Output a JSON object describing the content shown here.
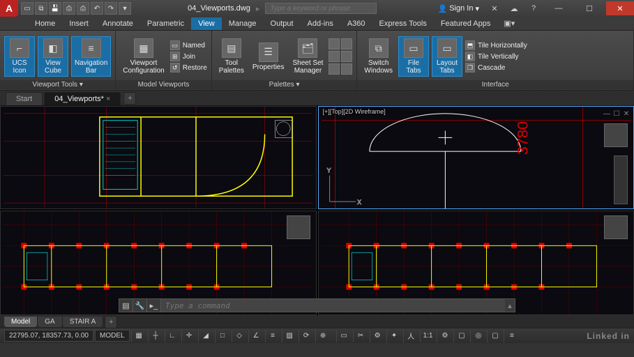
{
  "title": {
    "doc": "04_Viewports.dwg",
    "search_placeholder": "Type a keyword or phrase",
    "signin": "Sign In"
  },
  "tabs": [
    "Home",
    "Insert",
    "Annotate",
    "Parametric",
    "View",
    "Manage",
    "Output",
    "Add-ins",
    "A360",
    "Express Tools",
    "Featured Apps"
  ],
  "tabs_active": 4,
  "ribbon": {
    "viewport_tools": {
      "title": "Viewport Tools ▾",
      "ucs": "UCS\nIcon",
      "view": "View\nCube",
      "nav": "Navigation\nBar"
    },
    "model_viewports": {
      "title": "Model Viewports",
      "config": "Viewport\nConfiguration",
      "named": "Named",
      "join": "Join",
      "restore": "Restore"
    },
    "palettes": {
      "title": "Palettes ▾",
      "tool": "Tool\nPalettes",
      "props": "Properties",
      "sheet": "Sheet Set\nManager"
    },
    "interface": {
      "title": "Interface",
      "switch": "Switch\nWindows",
      "filetabs": "File\nTabs",
      "layouttabs": "Layout\nTabs",
      "tile_h": "Tile Horizontally",
      "tile_v": "Tile Vertically",
      "cascade": "Cascade"
    }
  },
  "file_tabs": {
    "start": "Start",
    "active": "04_Viewports*"
  },
  "viewport": {
    "label": "[+][Top][2D Wireframe]",
    "dim": "3780",
    "axis_x": "X",
    "axis_y": "Y"
  },
  "cmd": {
    "placeholder": "Type a command"
  },
  "layout_tabs": [
    "Model",
    "GA",
    "STAIR A"
  ],
  "status": {
    "coords": "22795.07, 18357.73, 0.00",
    "model": "MODEL",
    "scale": "1:1"
  },
  "watermark": "Linked in"
}
